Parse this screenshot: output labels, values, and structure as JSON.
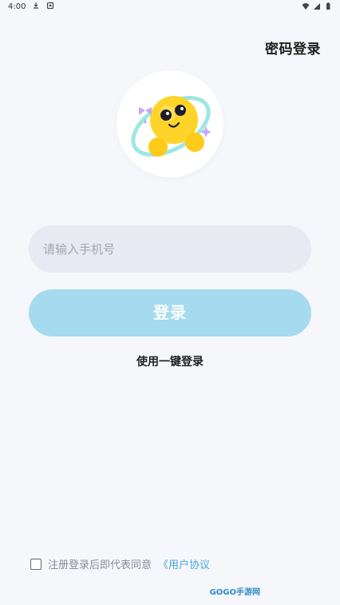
{
  "status_bar": {
    "time": "4:00"
  },
  "header": {
    "password_login": "密码登录"
  },
  "phone": {
    "placeholder": "请输入手机号",
    "value": ""
  },
  "actions": {
    "login_label": "登录",
    "one_click_login": "使用一键登录"
  },
  "agreement": {
    "checked": false,
    "text": "注册登录后即代表同意",
    "link_text": "《用户协议"
  },
  "watermark": {
    "text": "GOGO手游网"
  },
  "colors": {
    "background": "#f6f7fb",
    "input_bg": "#e8e9f2",
    "button_bg": "#a6daef",
    "link": "#46a7d6"
  },
  "icons": {
    "status": [
      "download-icon",
      "notification-icon",
      "wifi-icon",
      "signal-icon",
      "battery-icon"
    ],
    "avatar": "mascot-icon"
  }
}
